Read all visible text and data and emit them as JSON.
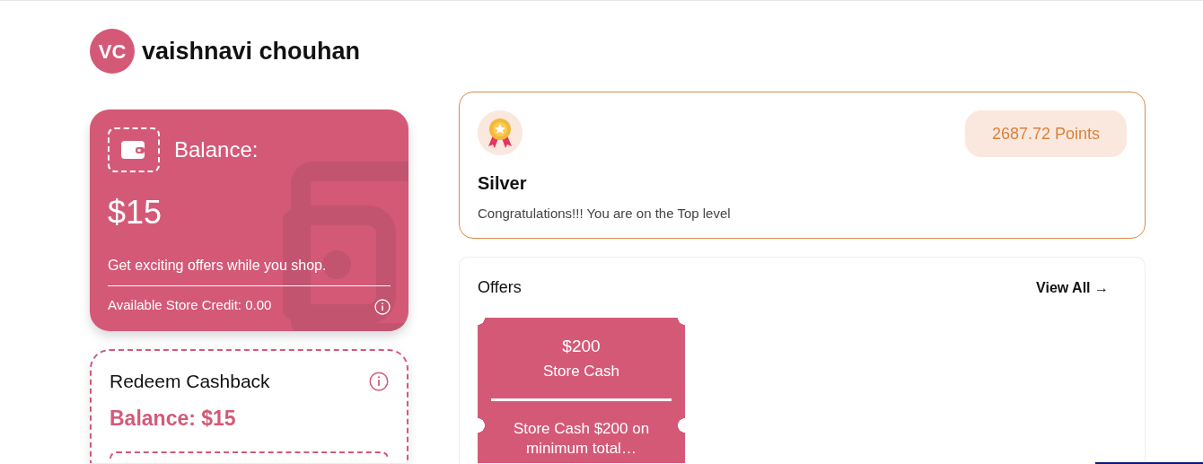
{
  "user": {
    "initials": "VC",
    "name": "vaishnavi chouhan"
  },
  "balance_card": {
    "label": "Balance:",
    "amount": "$15",
    "tagline": "Get exciting offers while you shop.",
    "store_credit": "Available Store Credit: 0.00"
  },
  "redeem_card": {
    "title": "Redeem Cashback",
    "balance": "Balance: $15"
  },
  "tier_card": {
    "tier": "Silver",
    "message": "Congratulations!!! You are on the Top level",
    "points": "2687.72 Points"
  },
  "offers": {
    "title": "Offers",
    "view_all": "View All",
    "arrow": "→",
    "items": [
      {
        "amount": "$200",
        "type": "Store Cash",
        "description": "Store Cash $200 on minimum total…"
      }
    ]
  }
}
